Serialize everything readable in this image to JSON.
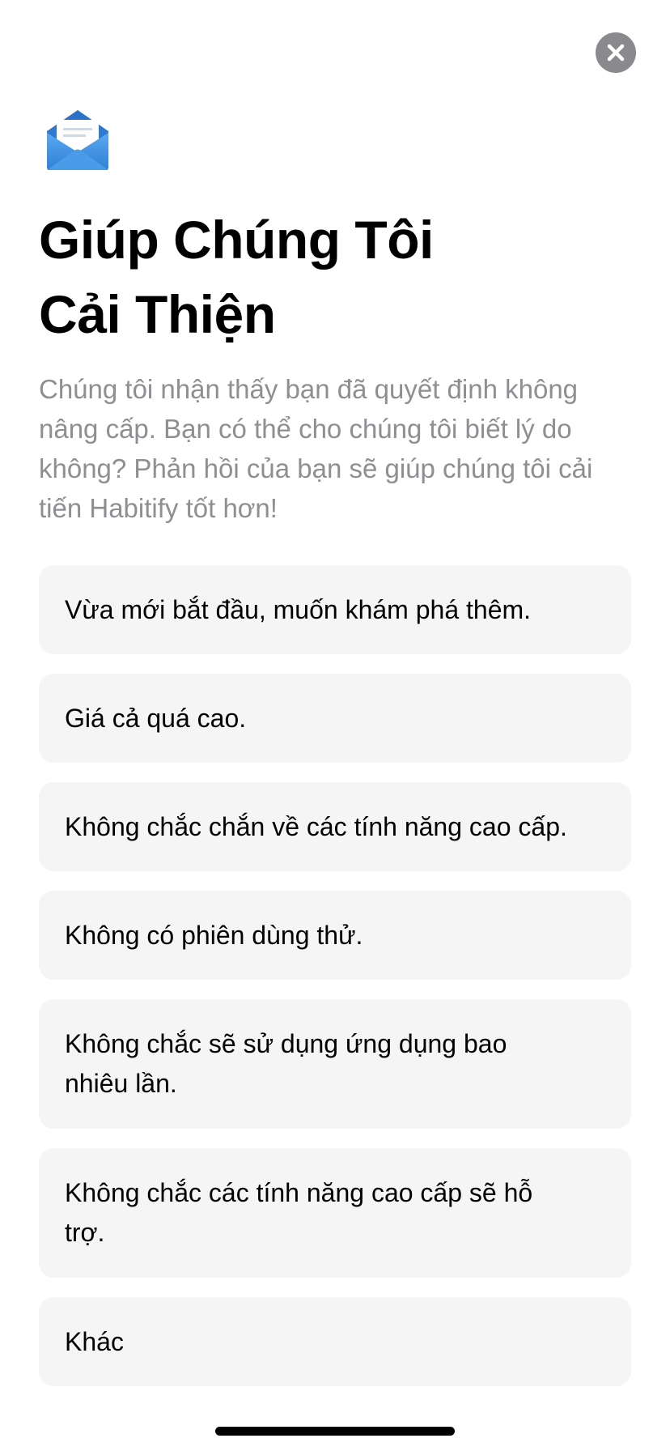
{
  "close_icon": "close-icon",
  "header_icon": "envelope-open-icon",
  "title": {
    "line1": "Giúp Chúng Tôi",
    "line2": "Cải Thiện"
  },
  "description": "Chúng tôi nhận thấy bạn đã quyết định không nâng cấp. Bạn có thể cho chúng tôi biết lý do không? Phản hồi của bạn sẽ giúp chúng tôi cải tiến Habitify tốt hơn!",
  "options": [
    {
      "label": "Vừa mới bắt đầu, muốn khám phá thêm."
    },
    {
      "label": "Giá cả quá cao."
    },
    {
      "label": "Không chắc chắn về các tính năng cao cấp."
    },
    {
      "label": "Không có phiên dùng thử."
    },
    {
      "label": "Không chắc sẽ sử dụng ứng dụng bao nhiêu lần."
    },
    {
      "label": "Không chắc các tính năng cao cấp sẽ hỗ trợ."
    },
    {
      "label": "Khác"
    }
  ],
  "colors": {
    "accent_blue": "#3b8fe0",
    "option_background": "#f5f5f5",
    "secondary_text": "#8e8e93",
    "close_button": "#8a8a8e"
  }
}
